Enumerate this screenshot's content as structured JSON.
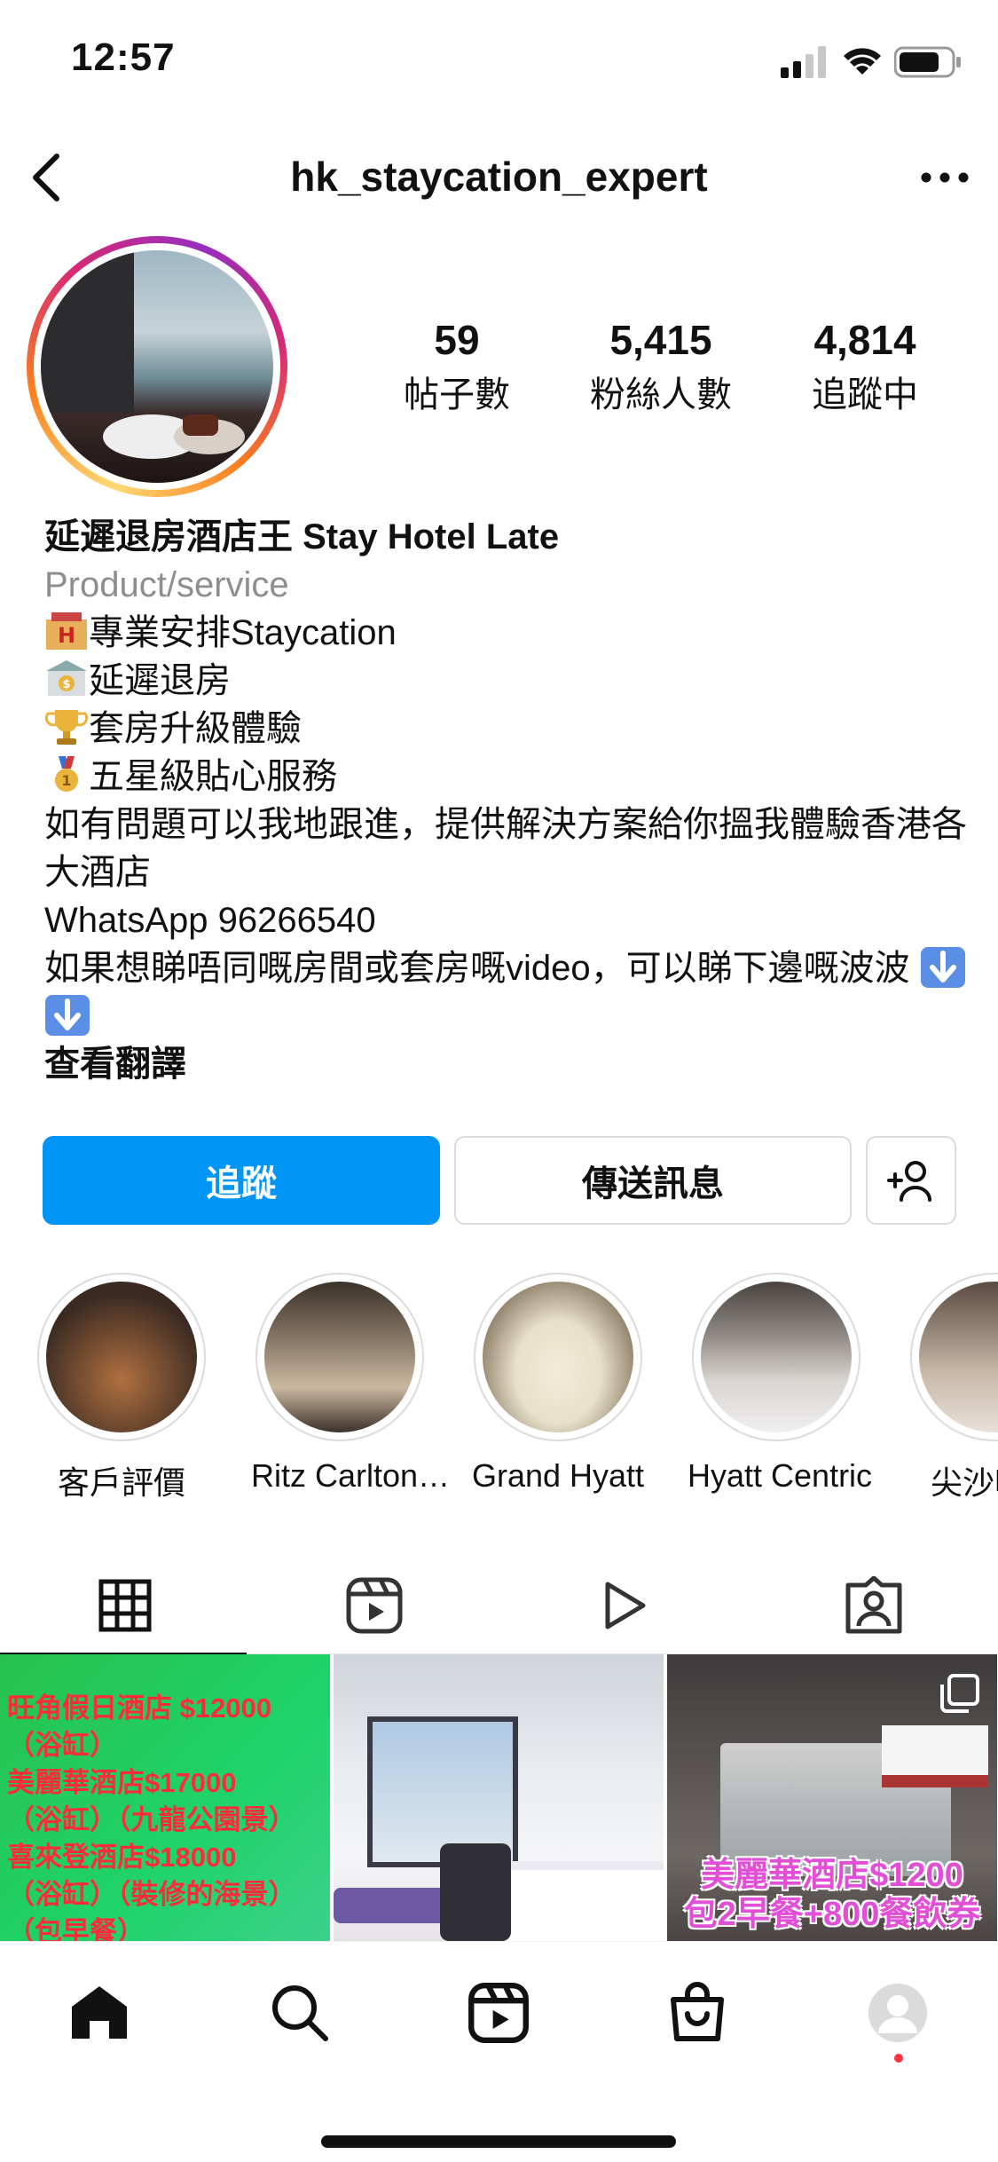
{
  "status_bar": {
    "time": "12:57"
  },
  "header": {
    "username": "hk_staycation_expert"
  },
  "stats": [
    {
      "value": "59",
      "label": "帖子數"
    },
    {
      "value": "5,415",
      "label": "粉絲人數"
    },
    {
      "value": "4,814",
      "label": "追蹤中"
    }
  ],
  "bio": {
    "name": "延遲退房酒店王 Stay Hotel Late",
    "category": "Product/service",
    "lines": [
      "專業安排Staycation",
      "延遲退房",
      "套房升級體驗",
      "五星級貼心服務"
    ],
    "description": "如有問題可以我地跟進，提供解決方案給你搵我體驗香港各大酒店",
    "whatsapp": "WhatsApp 96266540",
    "video_note": "如果想睇唔同嘅房間或套房嘅video，可以睇下邊嘅波波",
    "translate": "查看翻譯"
  },
  "actions": {
    "follow": "追蹤",
    "message": "傳送訊息"
  },
  "highlights": [
    {
      "label": "客戶評價",
      "colors": [
        "#3a2a22",
        "#b07040"
      ]
    },
    {
      "label": "Ritz Carlton…",
      "colors": [
        "#3b3128",
        "#cbb8a0"
      ]
    },
    {
      "label": "Grand Hyatt",
      "colors": [
        "#6b5a44",
        "#e8e0c8"
      ]
    },
    {
      "label": "Hyatt Centric",
      "colors": [
        "#4a4440",
        "#d8d4d0"
      ]
    },
    {
      "label": "尖沙咀…",
      "colors": [
        "#5a4a40",
        "#c8b8a8"
      ]
    }
  ],
  "posts": {
    "post1_lines": [
      "旺角假日酒店 $12000",
      "（浴缸）",
      "美麗華酒店$17000",
      "（浴缸）（九龍公園景）",
      "喜來登酒店$18000",
      "（浴缸）（裝修的海景）",
      "（包早餐）"
    ],
    "post3_caption_1": "美麗華酒店$1200",
    "post3_caption_2": "包2早餐+800餐飲券"
  },
  "colors": {
    "accent": "#0095f6",
    "notification": "#ff3040"
  }
}
